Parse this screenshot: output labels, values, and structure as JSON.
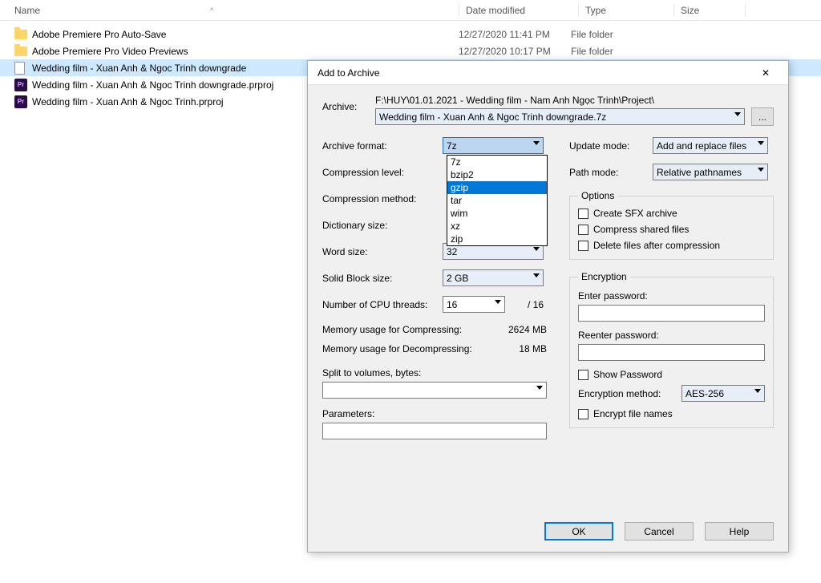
{
  "explorer": {
    "columns": {
      "name": "Name",
      "date": "Date modified",
      "type": "Type",
      "size": "Size"
    },
    "rows": [
      {
        "icon": "folder",
        "name": "Adobe Premiere Pro Auto-Save",
        "date": "12/27/2020 11:41 PM",
        "type": "File folder"
      },
      {
        "icon": "folder",
        "name": "Adobe Premiere Pro Video Previews",
        "date": "12/27/2020 10:17 PM",
        "type": "File folder"
      },
      {
        "icon": "file",
        "name": "Wedding film - Xuan Anh & Ngoc Trinh downgrade",
        "date": "",
        "type": "",
        "selected": true
      },
      {
        "icon": "pr",
        "name": "Wedding film - Xuan Anh & Ngoc Trinh downgrade.prproj",
        "date": "",
        "type": ""
      },
      {
        "icon": "pr",
        "name": "Wedding film - Xuan Anh & Ngoc Trinh.prproj",
        "date": "",
        "type": ""
      }
    ]
  },
  "dialog": {
    "title": "Add to Archive",
    "archive_label": "Archive:",
    "archive_path": "F:\\HUY\\01.01.2021 - Wedding film - Nam Anh  Ngọc Trinh\\Project\\",
    "archive_name": "Wedding film - Xuan Anh & Ngoc Trinh downgrade.7z",
    "browse": "...",
    "left": {
      "format_label": "Archive format:",
      "format_value": "7z",
      "format_options": [
        "7z",
        "bzip2",
        "gzip",
        "tar",
        "wim",
        "xz",
        "zip"
      ],
      "format_highlight": "gzip",
      "level_label": "Compression level:",
      "method_label": "Compression method:",
      "dict_label": "Dictionary size:",
      "word_label": "Word size:",
      "word_value": "32",
      "block_label": "Solid Block size:",
      "block_value": "2 GB",
      "cpu_label": "Number of CPU threads:",
      "cpu_value": "16",
      "cpu_total": "/ 16",
      "mem_comp_label": "Memory usage for Compressing:",
      "mem_comp_value": "2624 MB",
      "mem_decomp_label": "Memory usage for Decompressing:",
      "mem_decomp_value": "18 MB",
      "split_label": "Split to volumes, bytes:",
      "param_label": "Parameters:"
    },
    "right": {
      "update_label": "Update mode:",
      "update_value": "Add and replace files",
      "path_label": "Path mode:",
      "path_value": "Relative pathnames",
      "options_legend": "Options",
      "opt_sfx": "Create SFX archive",
      "opt_shared": "Compress shared files",
      "opt_delete": "Delete files after compression",
      "enc_legend": "Encryption",
      "enter_pw": "Enter password:",
      "reenter_pw": "Reenter password:",
      "show_pw": "Show Password",
      "enc_method_label": "Encryption method:",
      "enc_method_value": "AES-256",
      "enc_names": "Encrypt file names"
    },
    "buttons": {
      "ok": "OK",
      "cancel": "Cancel",
      "help": "Help"
    }
  }
}
